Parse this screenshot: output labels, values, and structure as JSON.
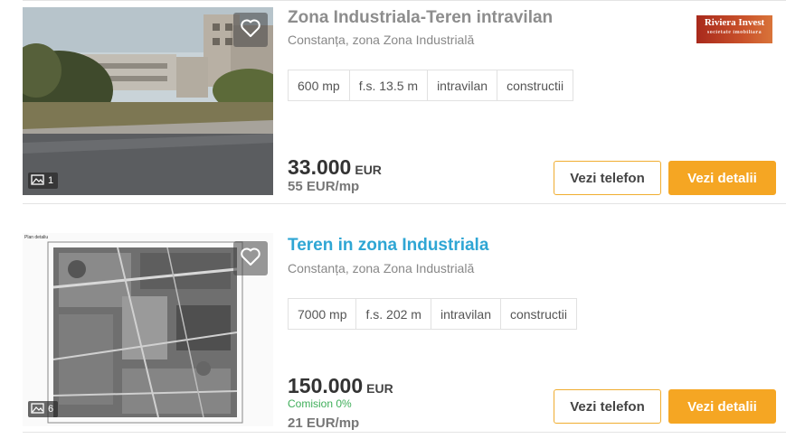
{
  "listings": [
    {
      "title": "Zona Industriala-Teren intravilan",
      "location": "Constanța, zona Zona Industrială",
      "features": [
        "600 mp",
        "f.s. 13.5 m",
        "intravilan",
        "constructii"
      ],
      "photo_count": "1",
      "price": "33.000",
      "currency": "EUR",
      "price_per_sqm": "55 EUR/mp",
      "agency_logo": {
        "line1": "Riviera Invest",
        "line2": "societate imobiliara"
      },
      "phone_button": "Vezi telefon",
      "details_button": "Vezi detalii"
    },
    {
      "title": "Teren in zona Industriala",
      "location": "Constanța, zona Zona Industrială",
      "features": [
        "7000 mp",
        "f.s. 202 m",
        "intravilan",
        "constructii"
      ],
      "photo_count": "6",
      "price": "150.000",
      "currency": "EUR",
      "commission": "Comision 0%",
      "price_per_sqm": "21 EUR/mp",
      "photo_caption": "Plan detaliu",
      "phone_button": "Vezi telefon",
      "details_button": "Vezi detalii"
    }
  ],
  "icons": {
    "favorite": "heart-outline-icon",
    "photos": "image-icon"
  },
  "colors": {
    "accent_orange": "#f5a623",
    "title_blue": "#2fa6d4",
    "commission_green": "#3fae5a"
  }
}
